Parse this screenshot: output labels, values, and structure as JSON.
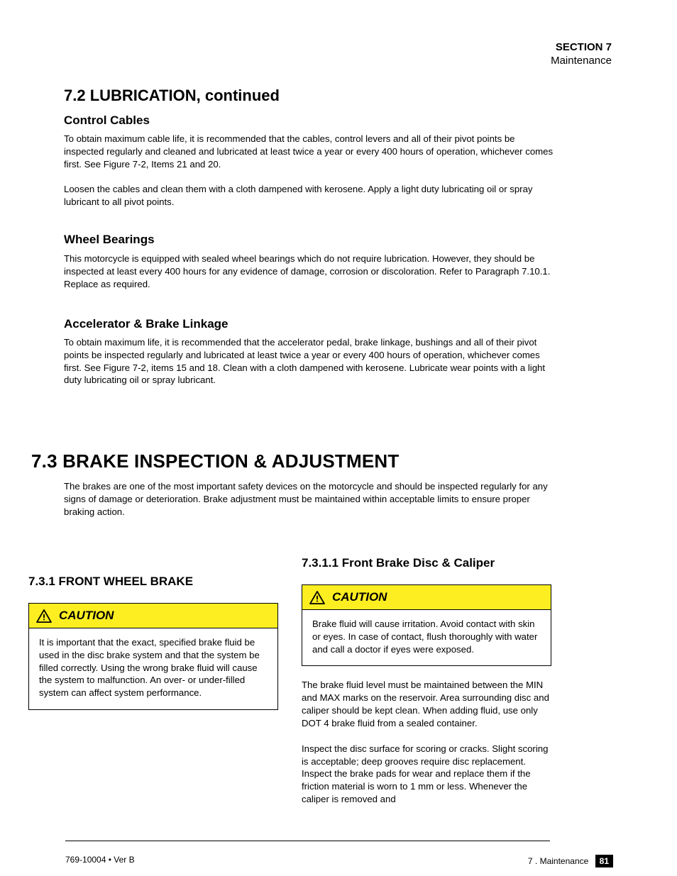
{
  "header": {
    "section": "SECTION 7",
    "subtitle": "Maintenance"
  },
  "section_title": "7.2 LUBRICATION, continued",
  "subs": {
    "cables": "Control Cables",
    "wheel": "Wheel Bearings",
    "throttle": "Accelerator & Brake Linkage"
  },
  "body": {
    "cables_p1": "To obtain maximum cable life, it is recommended that the cables, control levers and all of their pivot points be inspected regularly and cleaned and lubricated at least twice a year or every 400 hours of operation, whichever comes first. See Figure 7-2, Items 21 and 20.",
    "cables_p2": "Loosen the cables and clean them with a cloth dampened with kerosene. Apply a light duty lubricating oil or spray lubricant to all pivot points.",
    "wheel_p1": "This motorcycle is equipped with sealed wheel bearings which do not require lubrication. However, they should be inspected at least every 400 hours for any evidence of damage, corrosion or discoloration. Refer to Paragraph 7.10.1. Replace as required.",
    "throttle_p1": "To obtain maximum life, it is recommended that the accelerator pedal, brake linkage, bushings and all of their pivot points be inspected regularly and lubricated at least twice a year or every 400 hours of operation, whichever comes first. See Figure 7-2, items 15 and 18. Clean with a cloth dampened with kerosene. Lubricate wear points with a light duty lubricating oil or spray lubricant."
  },
  "main_heading": "7.3 BRAKE INSPECTION & ADJUSTMENT",
  "intro": "The brakes are one of the most important safety devices on the motorcycle and should be inspected regularly for any signs of damage or deterioration. Brake adjustment must be maintained within acceptable limits to ensure proper braking action.",
  "left_col": {
    "head": "7.3.1 FRONT WHEEL BRAKE",
    "caution_label": "CAUTION",
    "caution_body": "It is important that the exact, specified brake fluid be used in the disc brake system and that the system be filled correctly. Using the wrong brake fluid will cause the system to malfunction. An over- or under-filled system can affect system performance."
  },
  "right_col": {
    "head": "7.3.1.1 Front Brake Disc & Caliper",
    "caution_label": "CAUTION",
    "caution_body": "Brake fluid will cause irritation. Avoid contact with skin or eyes. In case of contact, flush thoroughly with water and call a doctor if eyes were exposed.",
    "trail_p1": "The brake fluid level must be maintained between the MIN and MAX marks on the reservoir. Area surrounding disc and caliper should be kept clean. When adding fluid, use only DOT 4 brake fluid from a sealed container.",
    "trail_p2": "Inspect the disc surface for scoring or cracks. Slight scoring is acceptable; deep grooves require disc replacement. Inspect the brake pads for wear and replace them if the friction material is worn to 1 mm or less. Whenever the caliper is removed and"
  },
  "footer": {
    "left": "769-10004 • Ver B",
    "right_label": "7 . Maintenance"
  },
  "page_number": "81"
}
